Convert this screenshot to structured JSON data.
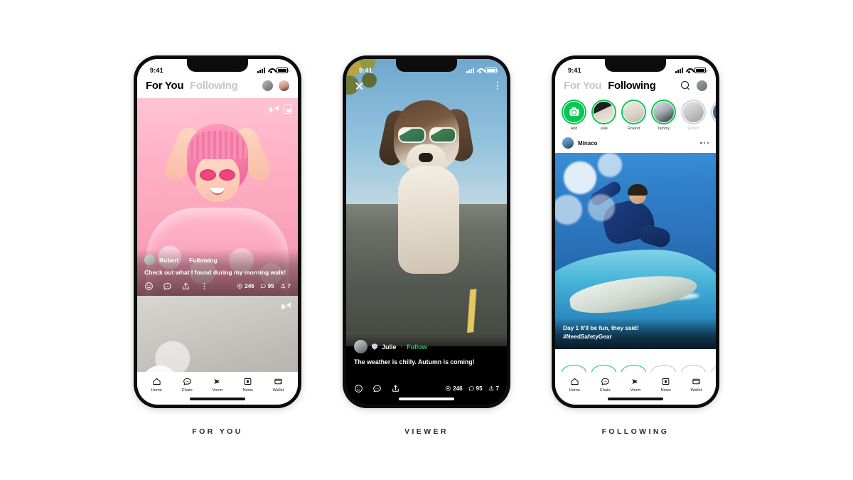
{
  "screens": [
    {
      "caption": "FOR YOU",
      "status_bar": {
        "time": "9:41",
        "icons": [
          "signal-icon",
          "wifi-icon",
          "battery-icon"
        ]
      },
      "header": {
        "tabs": [
          {
            "label": "For You",
            "active": true
          },
          {
            "label": "Following",
            "active": false
          }
        ],
        "actions": [
          "search-avatar-icon",
          "profile-avatar-icon"
        ]
      },
      "video_controls": [
        "mute-icon",
        "picture-in-picture-icon"
      ],
      "post": {
        "author": "Robert",
        "separator": "·",
        "relation": "Following",
        "caption": "Check out what I found during my morning walk!",
        "actions": [
          "reaction-icon",
          "comment-icon",
          "share-icon",
          "more-icon"
        ],
        "counts": [
          {
            "icon": "reaction-icon",
            "value": "246"
          },
          {
            "icon": "comment-icon",
            "value": "95"
          },
          {
            "icon": "share-icon",
            "value": "7"
          }
        ]
      },
      "next_post": {
        "mute": "mute-icon"
      },
      "nav": [
        {
          "label": "Home",
          "icon": "home-icon",
          "active": true
        },
        {
          "label": "Chats",
          "icon": "chat-icon",
          "active": false
        },
        {
          "label": "Voom",
          "icon": "voom-icon",
          "active": false
        },
        {
          "label": "News",
          "icon": "news-icon",
          "active": false
        },
        {
          "label": "Wallet",
          "icon": "wallet-icon",
          "active": false
        }
      ]
    },
    {
      "caption": "VIEWER",
      "status_bar": {
        "time": "9:41"
      },
      "top_bar": {
        "close": "close-icon",
        "more": "kebab-menu-icon"
      },
      "post": {
        "badge": "verified-shield-icon",
        "author": "Julie",
        "separator": "·",
        "follow_label": "Follow",
        "caption": "The weather is chilly. Autumn is coming!",
        "actions": [
          "reaction-icon",
          "comment-icon",
          "share-icon"
        ],
        "counts": [
          {
            "icon": "reaction-icon",
            "value": "246"
          },
          {
            "icon": "comment-icon",
            "value": "95"
          },
          {
            "icon": "share-icon",
            "value": "7"
          }
        ]
      }
    },
    {
      "caption": "FOLLOWING",
      "status_bar": {
        "time": "9:41"
      },
      "header": {
        "tabs": [
          {
            "label": "For You",
            "active": false
          },
          {
            "label": "Following",
            "active": true
          }
        ],
        "actions": [
          "search-icon",
          "profile-avatar-icon"
        ]
      },
      "stories": [
        {
          "label": "Add",
          "type": "add",
          "viewed": false
        },
        {
          "label": "Julie",
          "type": "story",
          "viewed": false
        },
        {
          "label": "Roland",
          "type": "story",
          "viewed": false
        },
        {
          "label": "Tammy",
          "type": "story",
          "viewed": false
        },
        {
          "label": "Robert",
          "type": "story",
          "viewed": true
        }
      ],
      "post": {
        "author": "Minaco",
        "more": "kebab-menu-icon",
        "caption_line1": "Day 1 It'll be fun, they said!",
        "caption_line2": "#NeedSafetyGear"
      },
      "fab": {
        "icon": "plus-icon",
        "color": "#09c35a"
      },
      "nav": [
        {
          "label": "Home",
          "icon": "home-icon",
          "active": true
        },
        {
          "label": "Chats",
          "icon": "chat-icon",
          "active": false
        },
        {
          "label": "Voom",
          "icon": "voom-icon",
          "active": false
        },
        {
          "label": "News",
          "icon": "news-icon",
          "active": false
        },
        {
          "label": "Wallet",
          "icon": "wallet-icon",
          "active": false
        }
      ]
    }
  ],
  "theme": {
    "brand_green": "#06c755",
    "follow_green": "#2ecc5f",
    "background": "#ffffff"
  }
}
